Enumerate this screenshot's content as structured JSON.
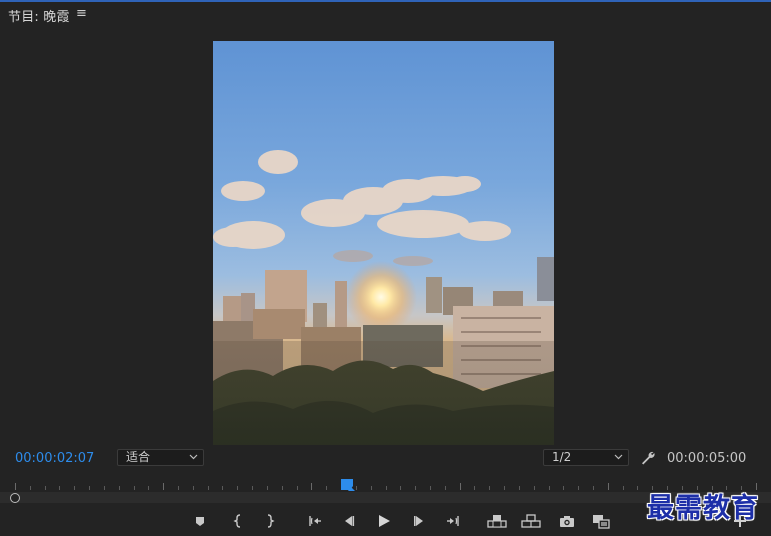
{
  "panel": {
    "title": "节目: 晚霞",
    "menu_glyph": "≡"
  },
  "timecodes": {
    "current": "00:00:02:07",
    "duration": "00:00:05:00"
  },
  "zoom_select": {
    "selected": "适合"
  },
  "resolution_select": {
    "selected": "1/2"
  },
  "playback": {
    "position_fraction": 0.45
  },
  "transport_icons": [
    "add-marker-icon",
    "mark-in-icon",
    "mark-out-icon",
    "go-to-in-icon",
    "step-back-icon",
    "play-icon",
    "step-forward-icon",
    "go-to-out-icon",
    "lift-icon",
    "extract-icon",
    "export-frame-icon",
    "comparison-view-icon"
  ],
  "watermark": {
    "text": "最需教育"
  },
  "colors": {
    "accent_blue": "#2d8ceb",
    "panel_bg": "#232323",
    "top_line": "#2f63b8",
    "watermark": "#1d2fa8"
  }
}
